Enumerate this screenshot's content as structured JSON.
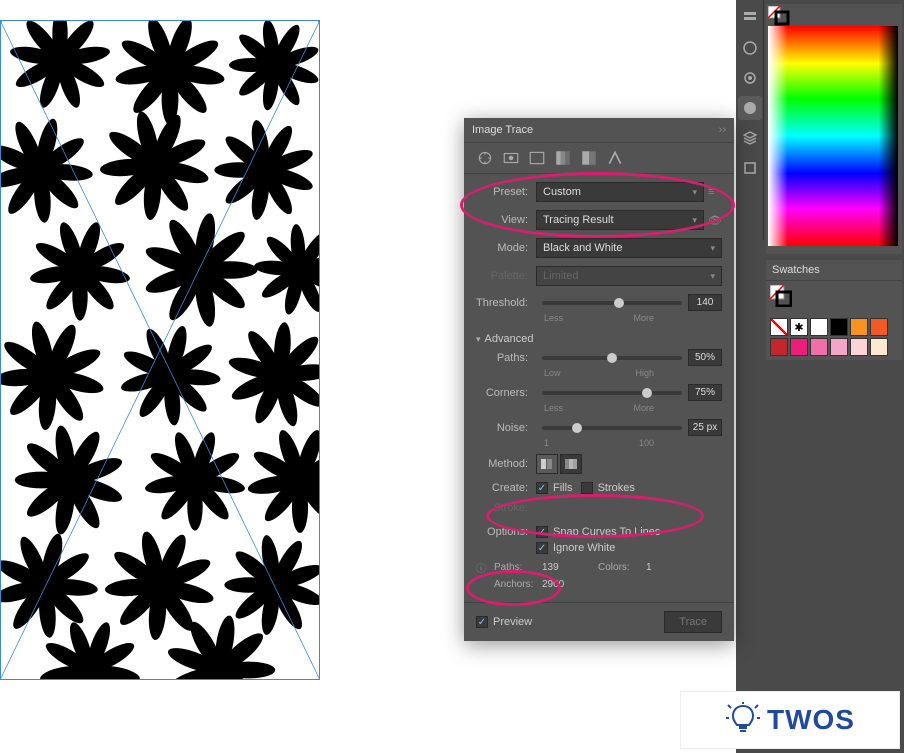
{
  "image_trace": {
    "title": "Image Trace",
    "preset_label": "Preset:",
    "preset_value": "Custom",
    "view_label": "View:",
    "view_value": "Tracing Result",
    "mode_label": "Mode:",
    "mode_value": "Black and White",
    "palette_label": "Palette:",
    "palette_value": "Limited",
    "threshold_label": "Threshold:",
    "threshold_value": "140",
    "threshold_min": "Less",
    "threshold_max": "More",
    "advanced_label": "Advanced",
    "paths_label": "Paths:",
    "paths_value": "50%",
    "paths_min": "Low",
    "paths_max": "High",
    "corners_label": "Corners:",
    "corners_value": "75%",
    "corners_min": "Less",
    "corners_max": "More",
    "noise_label": "Noise:",
    "noise_value": "25 px",
    "noise_min": "1",
    "noise_max": "100",
    "method_label": "Method:",
    "create_label": "Create:",
    "create_fills": "Fills",
    "create_strokes": "Strokes",
    "stroke_label": "Stroke:",
    "options_label": "Options:",
    "option_snap": "Snap Curves To Lines",
    "option_ignore": "Ignore White",
    "info_paths_label": "Paths:",
    "info_paths_value": "139",
    "info_colors_label": "Colors:",
    "info_colors_value": "1",
    "info_anchors_label": "Anchors:",
    "info_anchors_value": "2900",
    "preview_label": "Preview",
    "trace_button": "Trace"
  },
  "swatches": {
    "title": "Swatches",
    "colors": [
      "#f7931e",
      "#f15a24",
      "#c1272d",
      "#000000",
      "#ed1e79",
      "#f06eaa",
      "#f4a6c9",
      "#fbd4d9",
      "#fce9d0"
    ]
  },
  "watermark": {
    "text": "TWOS"
  }
}
